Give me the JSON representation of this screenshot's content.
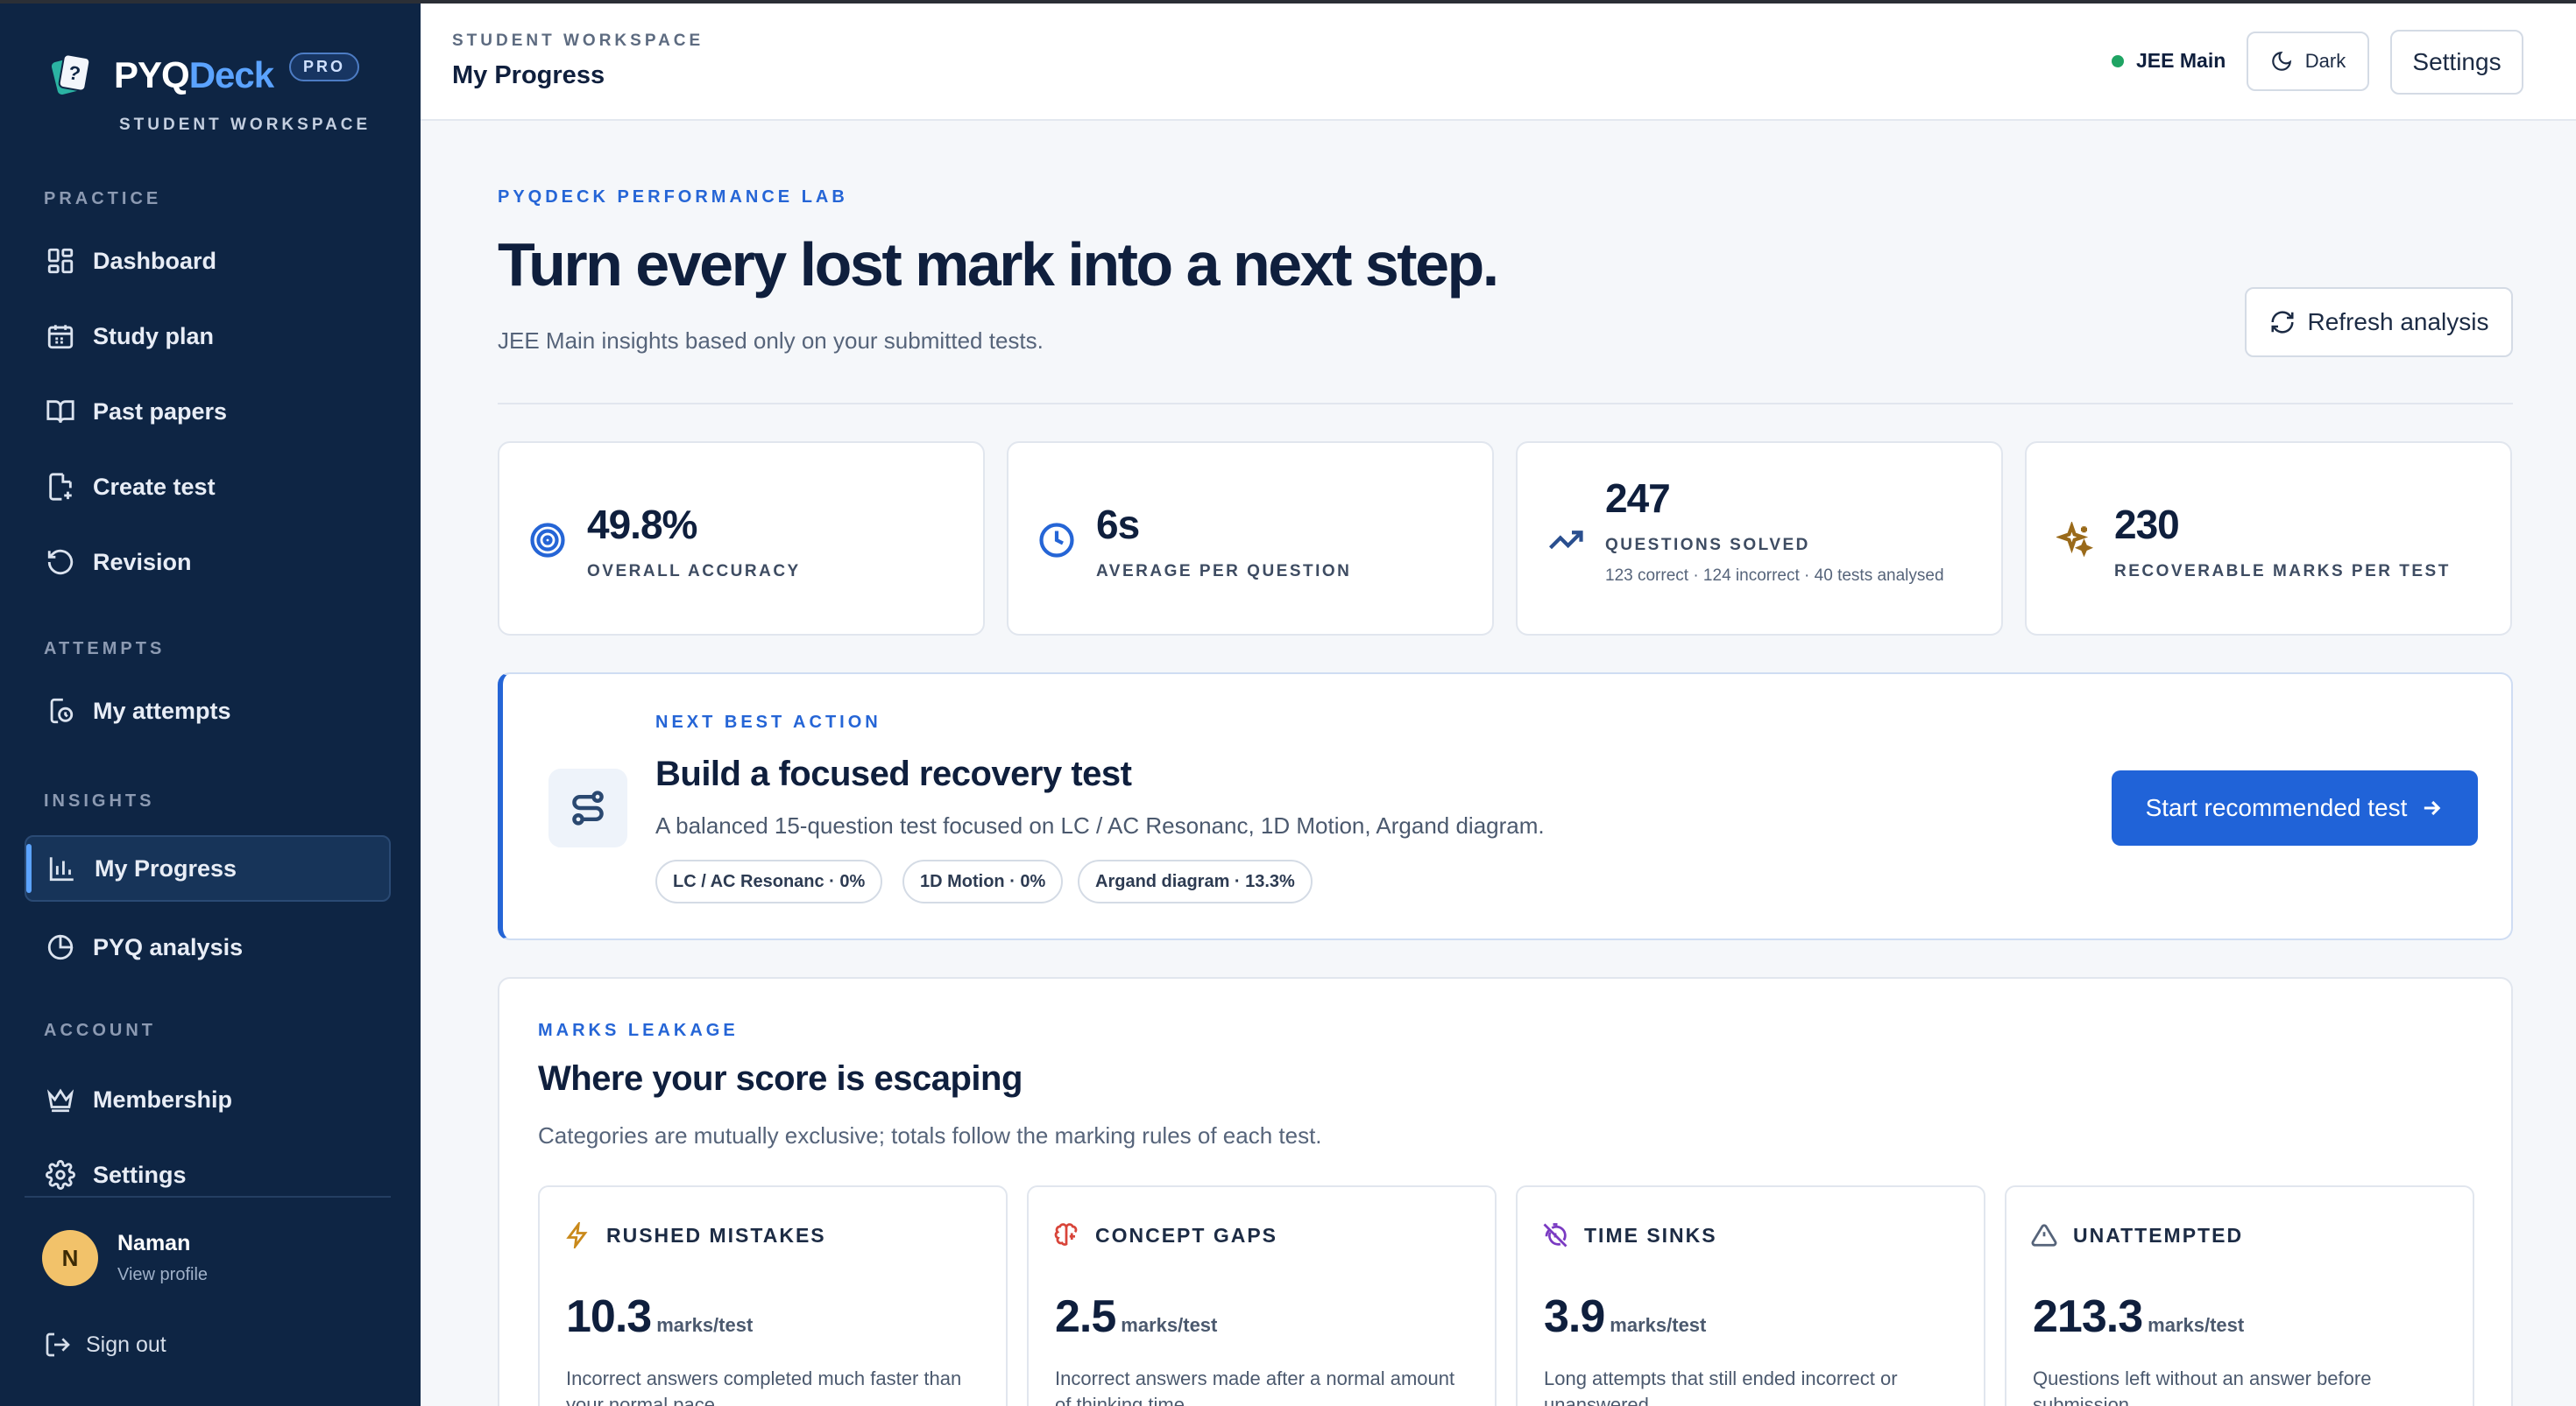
{
  "app": {
    "brand_first": "PYQ",
    "brand_second": "Deck",
    "badge": "PRO",
    "brand_sub": "STUDENT WORKSPACE"
  },
  "sidebar": {
    "sections": {
      "practice": "PRACTICE",
      "attempts": "ATTEMPTS",
      "insights": "INSIGHTS",
      "account": "ACCOUNT"
    },
    "items": [
      {
        "label": "Dashboard",
        "icon": "grid-icon"
      },
      {
        "label": "Study plan",
        "icon": "calendar-icon"
      },
      {
        "label": "Past papers",
        "icon": "book-icon"
      },
      {
        "label": "Create test",
        "icon": "file-plus-icon"
      },
      {
        "label": "Revision",
        "icon": "rotate-icon"
      },
      {
        "label": "My attempts",
        "icon": "history-icon"
      },
      {
        "label": "My Progress",
        "icon": "bar-chart-icon",
        "active": true
      },
      {
        "label": "PYQ analysis",
        "icon": "pie-chart-icon"
      },
      {
        "label": "Membership",
        "icon": "crown-icon"
      },
      {
        "label": "Settings",
        "icon": "gear-icon"
      }
    ],
    "profile": {
      "initial": "N",
      "name": "Naman",
      "link": "View profile"
    },
    "signout": "Sign out"
  },
  "header": {
    "overline": "STUDENT WORKSPACE",
    "title": "My Progress",
    "exam": "JEE Main",
    "theme_label": "Dark",
    "settings_label": "Settings"
  },
  "hero": {
    "eyebrow": "PYQDECK PERFORMANCE LAB",
    "title": "Turn every lost mark into a next step.",
    "subtitle": "JEE Main insights based only on your submitted tests.",
    "refresh_label": "Refresh analysis"
  },
  "stats": [
    {
      "value": "49.8%",
      "label": "OVERALL ACCURACY",
      "icon": "target-icon",
      "color": "#2565d6"
    },
    {
      "value": "6s",
      "label": "AVERAGE PER QUESTION",
      "icon": "clock-icon",
      "color": "#2565d6"
    },
    {
      "value": "247",
      "label": "QUESTIONS SOLVED",
      "note": "123 correct · 124 incorrect · 40 tests analysed",
      "icon": "trending-up-icon",
      "color": "#2a4f8f"
    },
    {
      "value": "230",
      "label": "RECOVERABLE MARKS PER TEST",
      "icon": "sparkle-icon",
      "color": "#9a6a1a"
    }
  ],
  "next_action": {
    "eyebrow": "NEXT BEST ACTION",
    "title": "Build a focused recovery test",
    "description": "A balanced 15-question test focused on LC / AC Resonanc, 1D Motion, Argand diagram.",
    "chips": [
      "LC / AC Resonanc · 0%",
      "1D Motion · 0%",
      "Argand diagram · 13.3%"
    ],
    "button_label": "Start recommended test"
  },
  "leakage": {
    "eyebrow": "MARKS LEAKAGE",
    "title": "Where your score is escaping",
    "subtitle": "Categories are mutually exclusive; totals follow the marking rules of each test.",
    "items": [
      {
        "title": "RUSHED MISTAKES",
        "value": "10.3",
        "unit": "marks/test",
        "desc": "Incorrect answers completed much faster than your normal pace",
        "icon": "zap-icon",
        "color": "#c9891a"
      },
      {
        "title": "CONCEPT GAPS",
        "value": "2.5",
        "unit": "marks/test",
        "desc": "Incorrect answers made after a normal amount of thinking time",
        "icon": "brain-icon",
        "color": "#d8453a"
      },
      {
        "title": "TIME SINKS",
        "value": "3.9",
        "unit": "marks/test",
        "desc": "Long attempts that still ended incorrect or unanswered",
        "icon": "timer-off-icon",
        "color": "#7a3ac2"
      },
      {
        "title": "UNATTEMPTED",
        "value": "213.3",
        "unit": "marks/test",
        "desc": "Questions left without an answer before submission",
        "icon": "alert-triangle-icon",
        "color": "#56647a"
      }
    ]
  }
}
